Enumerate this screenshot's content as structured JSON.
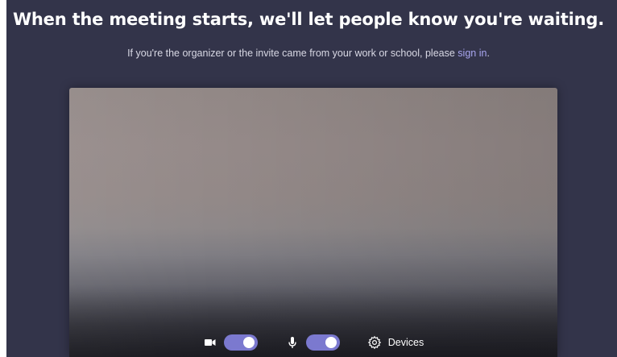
{
  "prejoin": {
    "headline": "When the meeting starts, we'll let people know you're waiting.",
    "subline_prefix": "If you're the organizer or the invite came from your work or school, please ",
    "sign_in_link": "sign in",
    "subline_suffix": "."
  },
  "controls": {
    "camera": {
      "icon": "camera-icon",
      "state": "on"
    },
    "microphone": {
      "icon": "microphone-icon",
      "state": "on"
    },
    "devices": {
      "icon": "gear-icon",
      "label": "Devices"
    }
  },
  "colors": {
    "background": "#33344a",
    "toggle_on": "#7b79cf",
    "link": "#a9a6f0"
  }
}
